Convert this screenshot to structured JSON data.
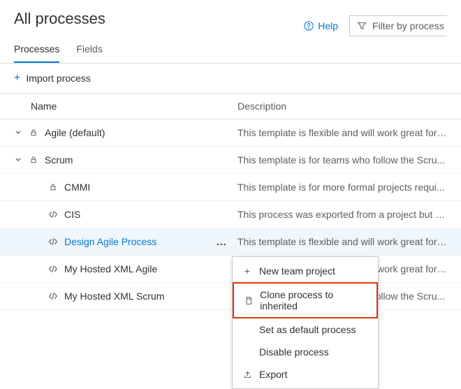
{
  "header": {
    "title": "All processes",
    "help_label": "Help",
    "filter_placeholder": "Filter by process name"
  },
  "tabs": {
    "processes": "Processes",
    "fields": "Fields"
  },
  "toolbar": {
    "import": "Import process"
  },
  "columns": {
    "name": "Name",
    "description": "Description"
  },
  "rows": [
    {
      "name": "Agile (default)",
      "description": "This template is flexible and will work great for ...",
      "expandable": true,
      "icon": "lock",
      "indent": 0,
      "link": false
    },
    {
      "name": "Scrum",
      "description": "This template is for teams who follow the Scru...",
      "expandable": true,
      "icon": "lock",
      "indent": 0,
      "link": false
    },
    {
      "name": "CMMI",
      "description": "This template is for more formal projects requi...",
      "expandable": false,
      "icon": "lock",
      "indent": 1,
      "link": false
    },
    {
      "name": "CIS",
      "description": "This process was exported from a project but n...",
      "expandable": false,
      "icon": "code",
      "indent": 1,
      "link": false
    },
    {
      "name": "Design Agile Process",
      "description": "This template is flexible and will work great for ...",
      "expandable": false,
      "icon": "code",
      "indent": 1,
      "link": true,
      "selected": true
    },
    {
      "name": "My Hosted XML Agile",
      "description": "This template is flexible and will work great for ...",
      "expandable": false,
      "icon": "code",
      "indent": 1,
      "link": false
    },
    {
      "name": "My Hosted XML Scrum",
      "description": "This template is for teams who follow the Scru...",
      "expandable": false,
      "icon": "code",
      "indent": 1,
      "link": false
    }
  ],
  "menu": {
    "new_project": "New team project",
    "clone": "Clone process to inherited",
    "set_default": "Set as default process",
    "disable": "Disable process",
    "export": "Export"
  },
  "ellipsis": "..."
}
